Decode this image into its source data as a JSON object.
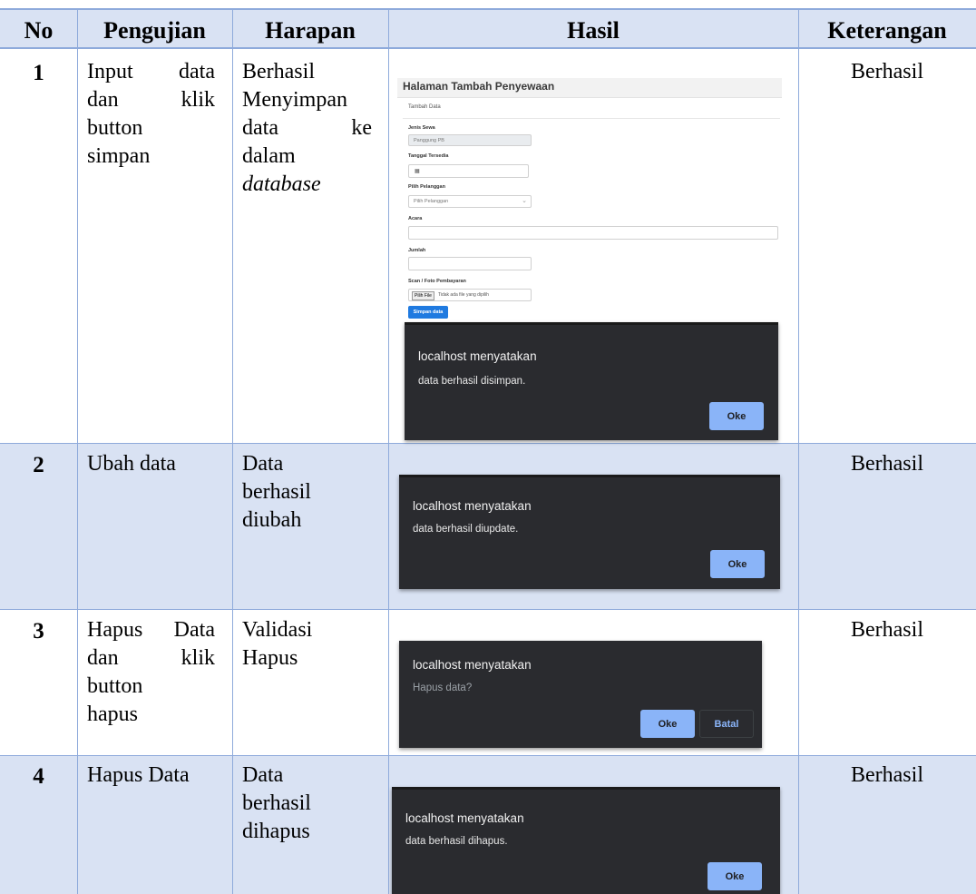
{
  "headers": {
    "no": "No",
    "pengujian": "Pengujian",
    "harapan": "Harapan",
    "hasil": "Hasil",
    "keterangan": "Keterangan"
  },
  "rows": [
    {
      "no": "1",
      "pengujian": [
        "Input data",
        "dan klik",
        "button",
        "simpan"
      ],
      "harapan": [
        "Berhasil",
        "Menyimpan",
        "data ke",
        "dalam",
        "database"
      ],
      "keterangan": "Berhasil"
    },
    {
      "no": "2",
      "pengujian": [
        "Ubah data"
      ],
      "harapan": [
        "Data",
        "berhasil",
        "diubah"
      ],
      "keterangan": "Berhasil"
    },
    {
      "no": "3",
      "pengujian": [
        "Hapus Data",
        "dan klik",
        "button",
        "hapus"
      ],
      "harapan": [
        "Validasi",
        "Hapus"
      ],
      "keterangan": "Berhasil"
    },
    {
      "no": "4",
      "pengujian": [
        "Hapus Data"
      ],
      "harapan": [
        "Data",
        "berhasil",
        "dihapus"
      ],
      "keterangan": "Berhasil"
    }
  ],
  "form": {
    "title": "Halaman Tambah Penyewaan",
    "subtab": "Tambah Data",
    "jenis_label": "Jenis Sewa",
    "jenis_value": "Panggung PB",
    "tanggal_label": "Tanggal Tersedia",
    "pelanggan_label": "Pilih Pelanggan",
    "pelanggan_placeholder": "Pilih Pelanggan",
    "acara_label": "Acara",
    "jumlah_label": "Jumlah",
    "scan_label": "Scan / Foto Pembayaran",
    "file_button": "Pilih File",
    "file_status": "Tidak ada file yang dipilih",
    "submit": "Simpan data"
  },
  "dialogs": [
    {
      "title": "localhost menyatakan",
      "message": "data berhasil disimpan.",
      "ok": "Oke"
    },
    {
      "title": "localhost menyatakan",
      "message": "data berhasil diupdate.",
      "ok": "Oke"
    },
    {
      "title": "localhost menyatakan",
      "message": "Hapus data?",
      "ok": "Oke",
      "cancel": "Batal"
    },
    {
      "title": "localhost menyatakan",
      "message": "data berhasil dihapus.",
      "ok": "Oke"
    }
  ],
  "colors": {
    "header_bg": "#d9e2f3",
    "border": "#8eaadb",
    "dialog_bg": "#2a2b2f",
    "dialog_button": "#8ab4f8",
    "form_button": "#1f7ae0"
  }
}
